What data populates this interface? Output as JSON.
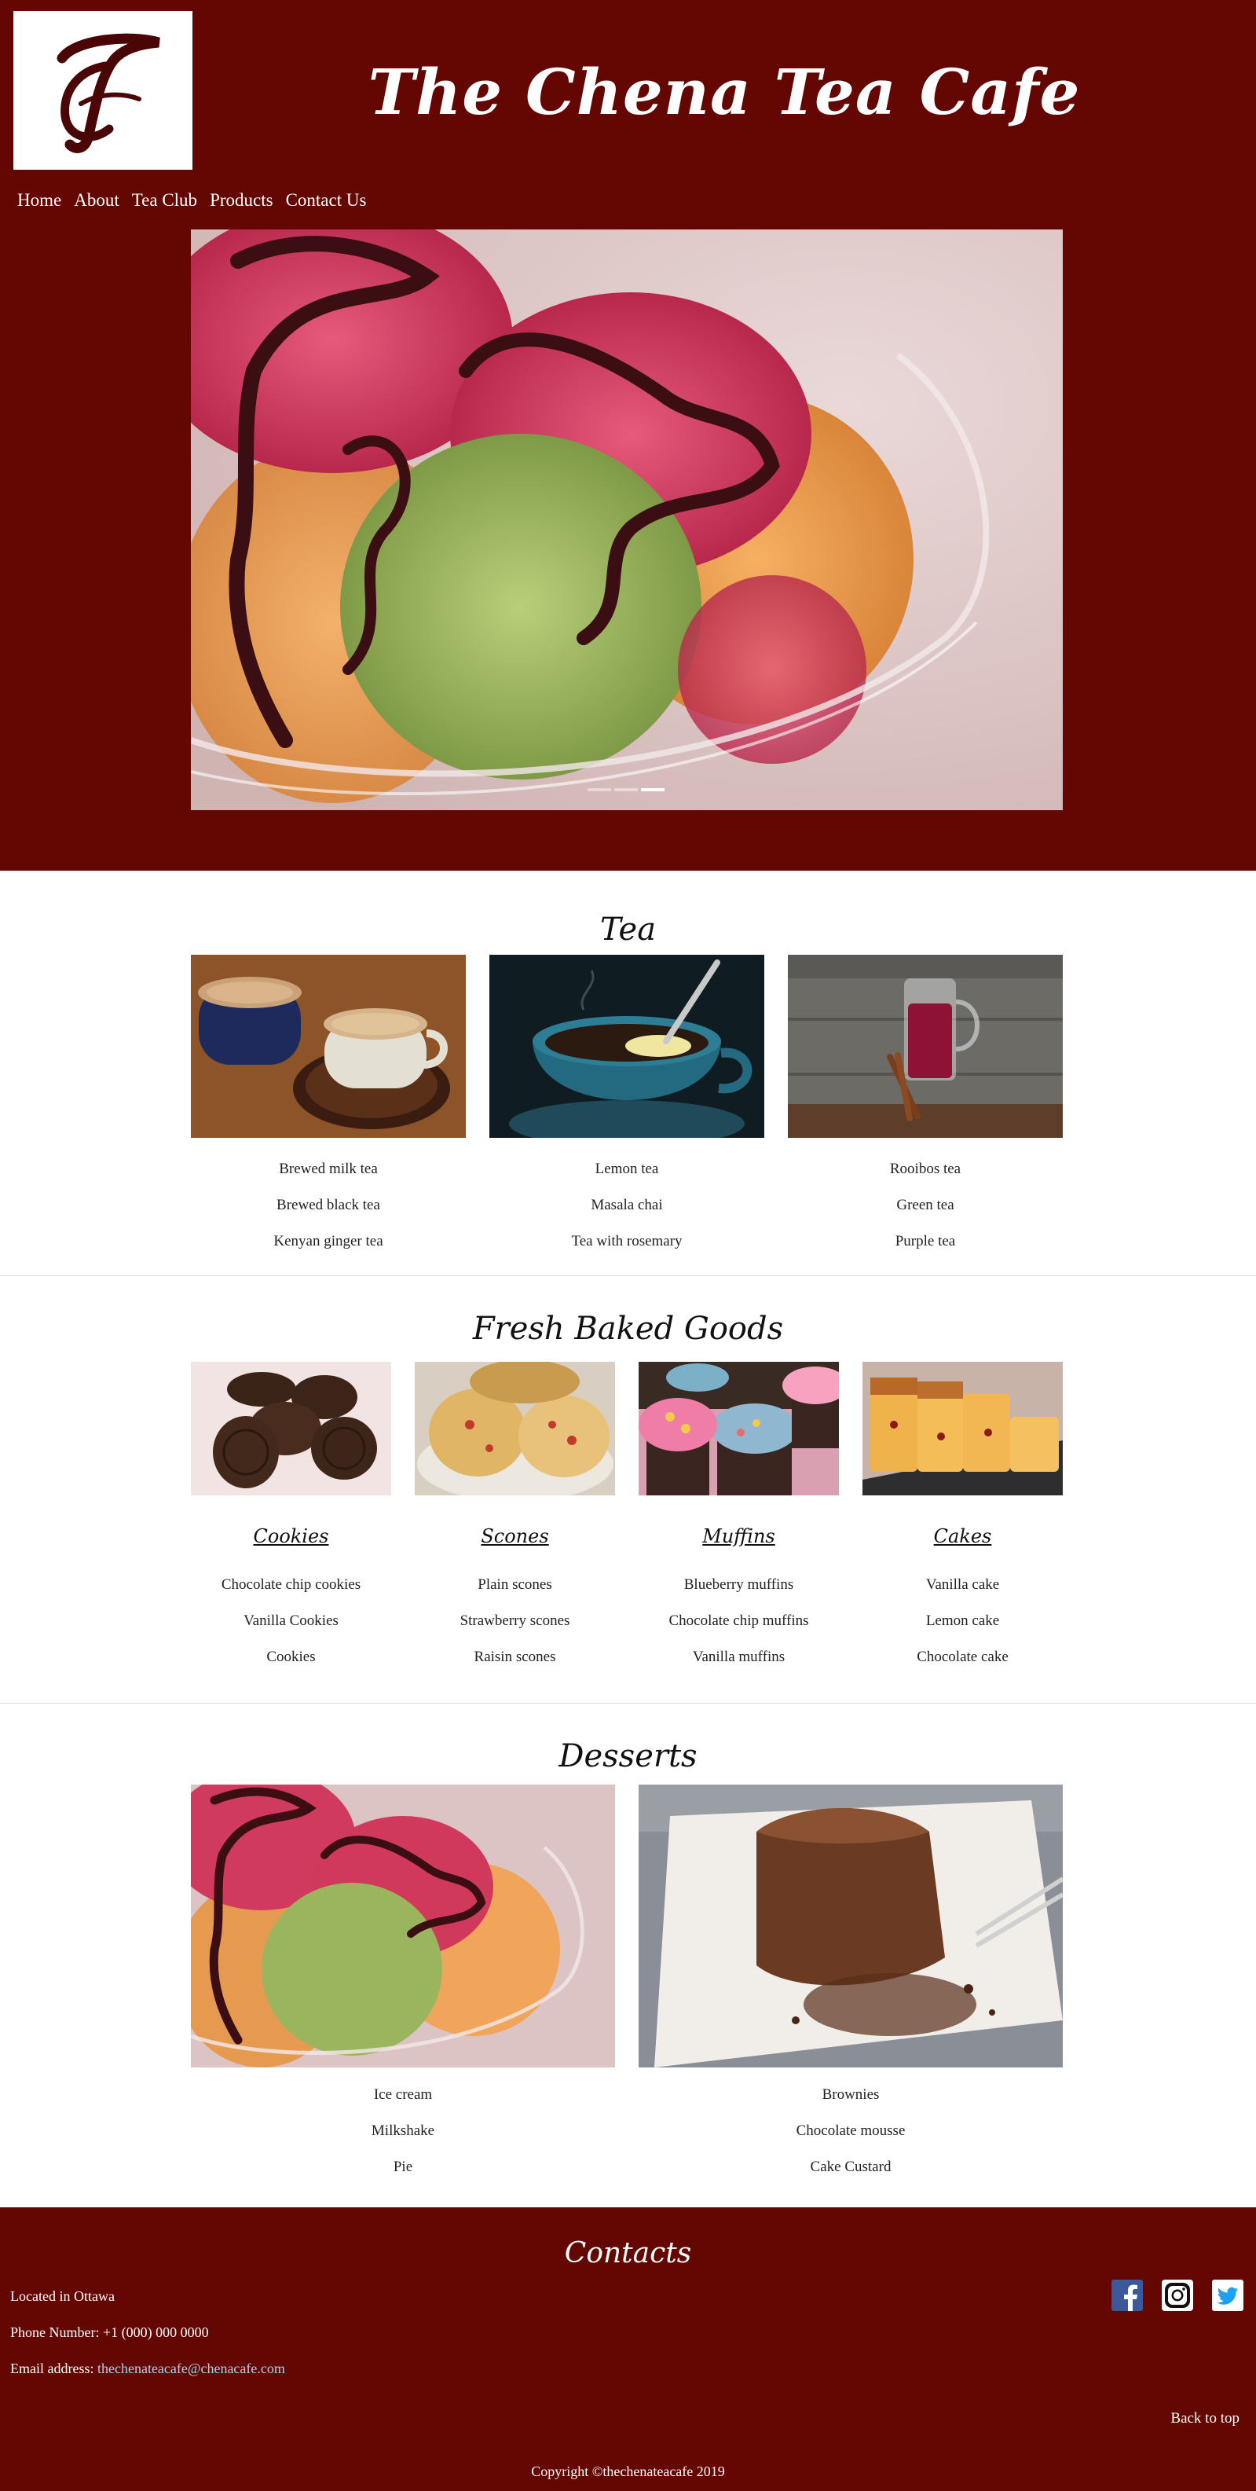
{
  "header": {
    "logo_alt": "TC",
    "title": "The Chena Tea Cafe"
  },
  "nav": [
    "Home",
    "About",
    "Tea Club",
    "Products",
    "Contact Us"
  ],
  "hero": {
    "image": "ice-cream-sorbet-photo",
    "slide_count": 3,
    "active_slide": 3
  },
  "tea": {
    "heading": "Tea",
    "columns": [
      {
        "image": "milk-tea-cups-photo",
        "items": [
          "Brewed milk tea",
          "Brewed black tea",
          "Kenyan ginger tea"
        ]
      },
      {
        "image": "lemon-tea-cup-photo",
        "items": [
          "Lemon tea",
          "Masala chai",
          "Tea with rosemary"
        ]
      },
      {
        "image": "red-tea-glass-photo",
        "items": [
          "Rooibos tea",
          "Green tea",
          "Purple tea"
        ]
      }
    ]
  },
  "baked": {
    "heading": "Fresh Baked Goods",
    "columns": [
      {
        "image": "cookies-photo",
        "title": "Cookies",
        "items": [
          "Chocolate chip cookies",
          "Vanilla Cookies",
          "Cookies"
        ]
      },
      {
        "image": "scones-photo",
        "title": "Scones",
        "items": [
          "Plain scones",
          "Strawberry scones",
          "Raisin scones"
        ]
      },
      {
        "image": "muffins-photo",
        "title": "Muffins",
        "items": [
          "Blueberry muffins",
          "Chocolate chip muffins",
          "Vanilla muffins"
        ]
      },
      {
        "image": "cakes-photo",
        "title": "Cakes",
        "items": [
          "Vanilla cake",
          "Lemon cake",
          "Chocolate cake"
        ]
      }
    ]
  },
  "desserts": {
    "heading": "Desserts",
    "columns": [
      {
        "image": "ice-cream-photo",
        "items": [
          "Ice cream",
          "Milkshake",
          "Pie"
        ]
      },
      {
        "image": "brownie-photo",
        "items": [
          "Brownies",
          "Chocolate mousse",
          "Cake Custard"
        ]
      }
    ]
  },
  "footer": {
    "heading": "Contacts",
    "location": "Located in Ottawa",
    "phone": "Phone Number: +1 (000) 000 0000",
    "email_label": "Email address: ",
    "email": "thechenateacafe@chenacafe.com",
    "social": [
      "facebook-icon",
      "instagram-icon",
      "twitter-icon"
    ],
    "back_to_top": "Back to top",
    "copyright": "Copyright ©thechenateacafe 2019"
  },
  "colors": {
    "brand_maroon": "#640602",
    "link_blue": "#a8d4f0",
    "facebook": "#3b5998",
    "twitter": "#1da1f2"
  }
}
